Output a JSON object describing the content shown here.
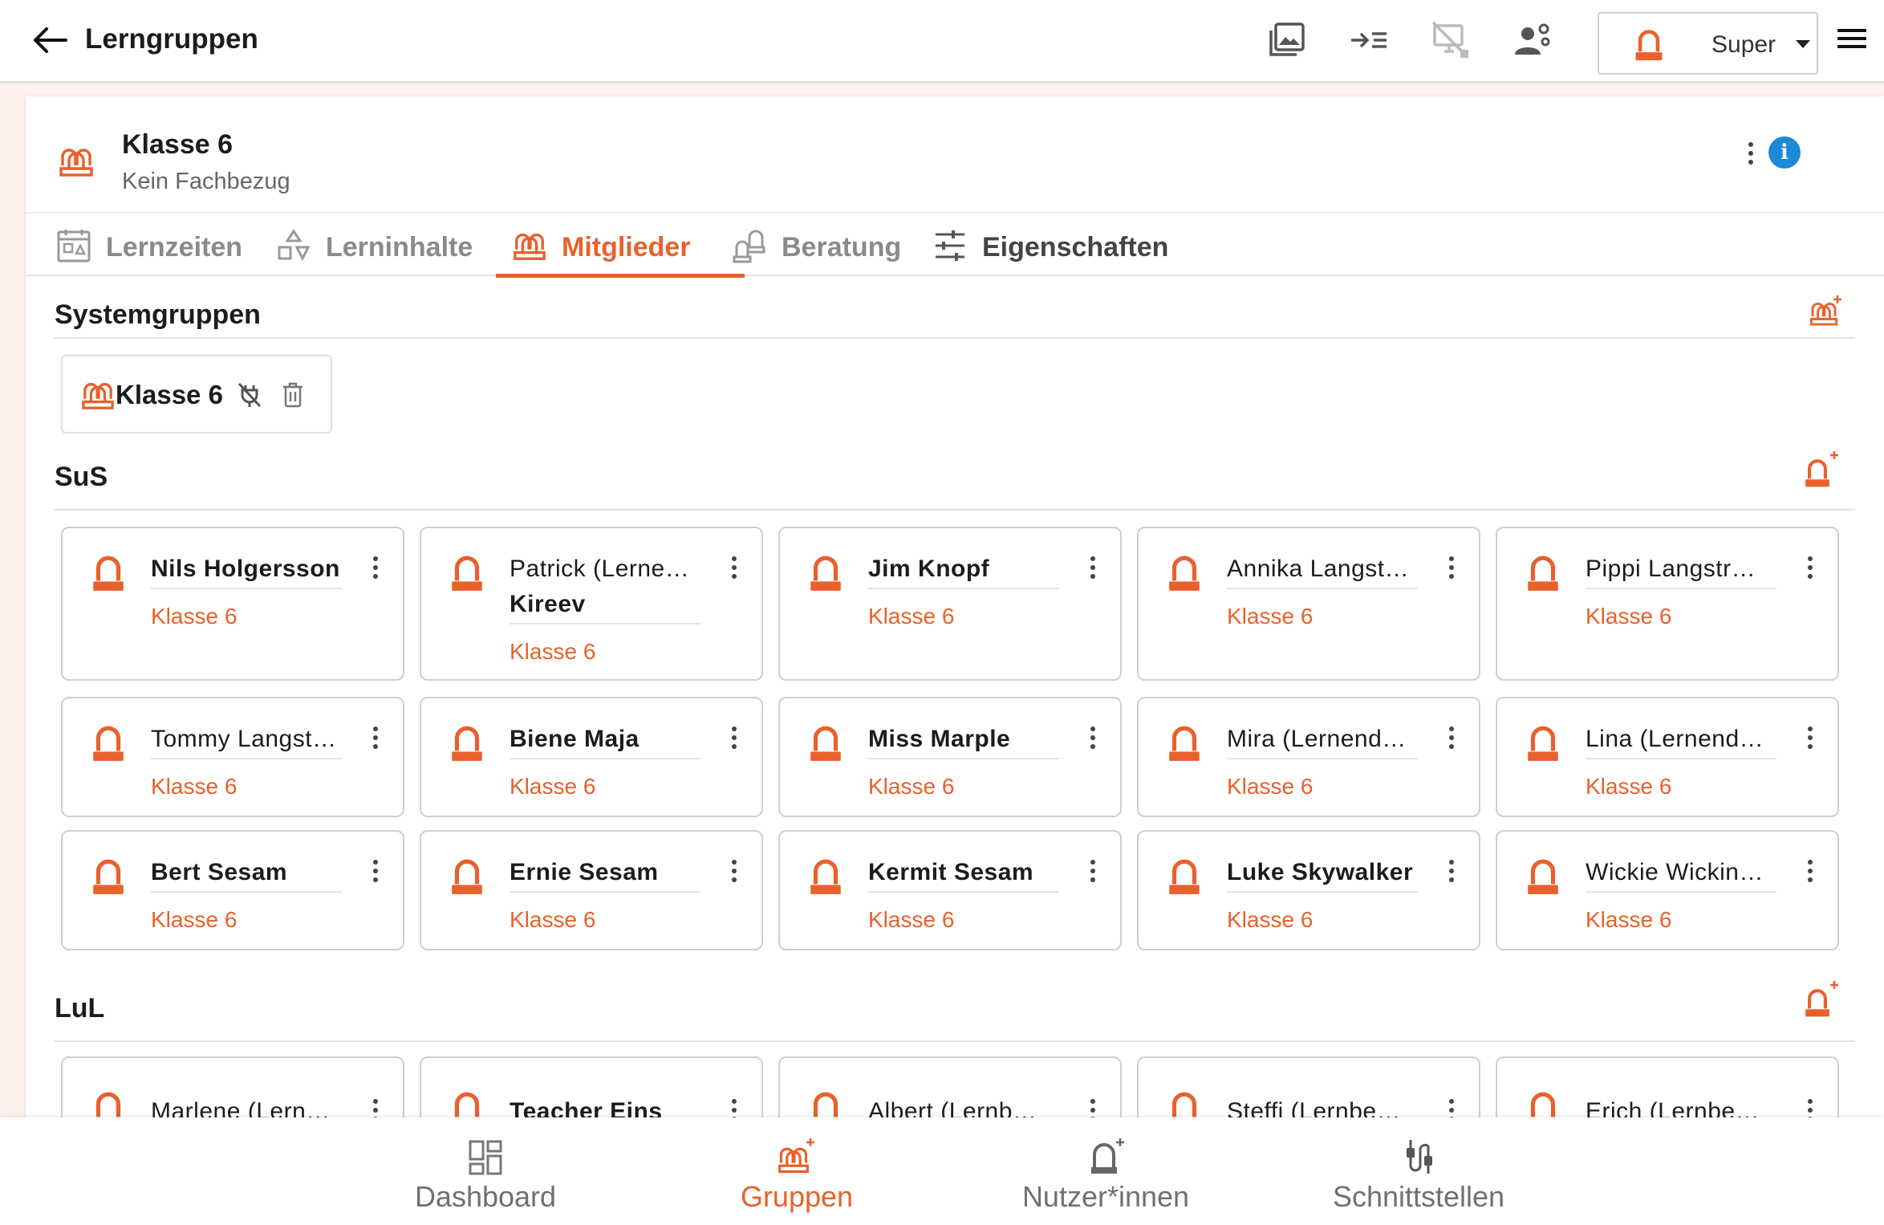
{
  "header": {
    "title": "Lerngruppen",
    "user_select": {
      "value": "Super"
    }
  },
  "colors": {
    "accent": "#e8612c",
    "info": "#1a8ad6"
  },
  "group": {
    "title": "Klasse 6",
    "subtitle": "Kein Fachbezug"
  },
  "tabs": [
    {
      "label": "Lernzeiten",
      "icon": "calendar-icon"
    },
    {
      "label": "Lerninhalte",
      "icon": "shapes-icon"
    },
    {
      "label": "Mitglieder",
      "icon": "group-icon",
      "active": true
    },
    {
      "label": "Beratung",
      "icon": "consultation-icon"
    },
    {
      "label": "Eigenschaften",
      "icon": "sliders-icon"
    }
  ],
  "sections": {
    "system": {
      "title": "Systemgruppen",
      "chip_label": "Klasse 6"
    },
    "sus": {
      "title": "SuS"
    },
    "lul": {
      "title": "LuL"
    }
  },
  "students": [
    {
      "name": "Nils Holgersson",
      "group": "Klasse 6",
      "bold": true
    },
    {
      "name": "Patrick (Lerne…",
      "name2": "Kireev",
      "group": "Klasse 6",
      "bold": false
    },
    {
      "name": "Jim Knopf",
      "group": "Klasse 6",
      "bold": true
    },
    {
      "name": "Annika Langst…",
      "group": "Klasse 6",
      "bold": false
    },
    {
      "name": "Pippi Langstr…",
      "group": "Klasse 6",
      "bold": false
    },
    {
      "name": "Tommy Langst…",
      "group": "Klasse 6",
      "bold": false
    },
    {
      "name": "Biene Maja",
      "group": "Klasse 6",
      "bold": true
    },
    {
      "name": "Miss Marple",
      "group": "Klasse 6",
      "bold": true
    },
    {
      "name": "Mira (Lernend…",
      "group": "Klasse 6",
      "bold": false
    },
    {
      "name": "Lina (Lernend…",
      "group": "Klasse 6",
      "bold": false
    },
    {
      "name": "Bert Sesam",
      "group": "Klasse 6",
      "bold": true
    },
    {
      "name": "Ernie Sesam",
      "group": "Klasse 6",
      "bold": true
    },
    {
      "name": "Kermit Sesam",
      "group": "Klasse 6",
      "bold": true
    },
    {
      "name": "Luke Skywalker",
      "group": "Klasse 6",
      "bold": true
    },
    {
      "name": "Wickie Wickin…",
      "group": "Klasse 6",
      "bold": false
    }
  ],
  "teachers": [
    {
      "name": "Marlene (Lern…",
      "bold": false
    },
    {
      "name": "Teacher Eins",
      "bold": true
    },
    {
      "name": "Albert (Lernb…",
      "bold": false
    },
    {
      "name": "Steffi (Lernbe…",
      "bold": false
    },
    {
      "name": "Erich (Lernbe…",
      "bold": false
    }
  ],
  "bottom_nav": [
    {
      "label": "Dashboard",
      "icon": "dashboard-icon"
    },
    {
      "label": "Gruppen",
      "icon": "groups-icon",
      "active": true
    },
    {
      "label": "Nutzer*innen",
      "icon": "users-icon"
    },
    {
      "label": "Schnittstellen",
      "icon": "interfaces-icon"
    }
  ]
}
